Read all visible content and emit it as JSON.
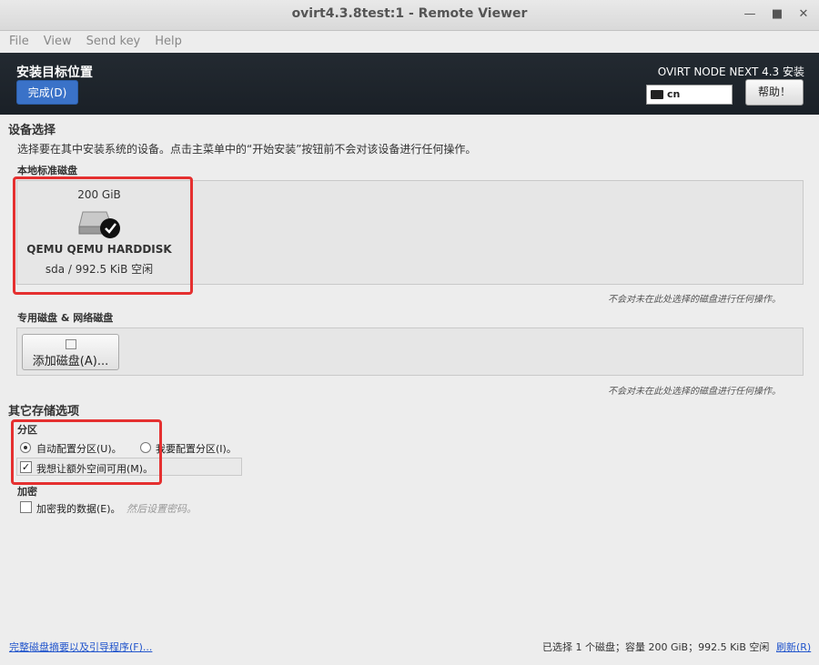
{
  "window": {
    "title": "ovirt4.3.8test:1 - Remote Viewer"
  },
  "menu": {
    "file": "File",
    "view": "View",
    "sendkey": "Send key",
    "help": "Help"
  },
  "header": {
    "page_title": "安装目标位置",
    "done_label": "完成(D)",
    "product": "OVIRT NODE NEXT 4.3 安装",
    "keyboard": "cn",
    "help_label": "帮助！"
  },
  "device": {
    "section_title": "设备选择",
    "description": "选择要在其中安装系统的设备。点击主菜单中的“开始安装”按钮前不会对该设备进行任何操作。",
    "local_title": "本地标准磁盘",
    "disk": {
      "size": "200 GiB",
      "name": "QEMU QEMU HARDDISK",
      "free": "sda   /   992.5 KiB 空闲"
    },
    "local_note": "不会对未在此处选择的磁盘进行任何操作。",
    "special_title": "专用磁盘 & 网络磁盘",
    "add_disk_label": "添加磁盘(A)...",
    "special_note": "不会对未在此处选择的磁盘进行任何操作。"
  },
  "storage": {
    "section_title": "其它存储选项",
    "partition_title": "分区",
    "auto_label": "自动配置分区(U)。",
    "manual_label": "我要配置分区(I)。",
    "extra_space_label": "我想让额外空间可用(M)。",
    "encrypt_title": "加密",
    "encrypt_label": "加密我的数据(E)。",
    "encrypt_hint": "然后设置密码。"
  },
  "footer": {
    "summary_link": "完整磁盘摘要以及引导程序(F)...",
    "status": "已选择 1 个磁盘；容量 200 GiB；992.5 KiB 空闲",
    "refresh": "刷新(R)"
  }
}
